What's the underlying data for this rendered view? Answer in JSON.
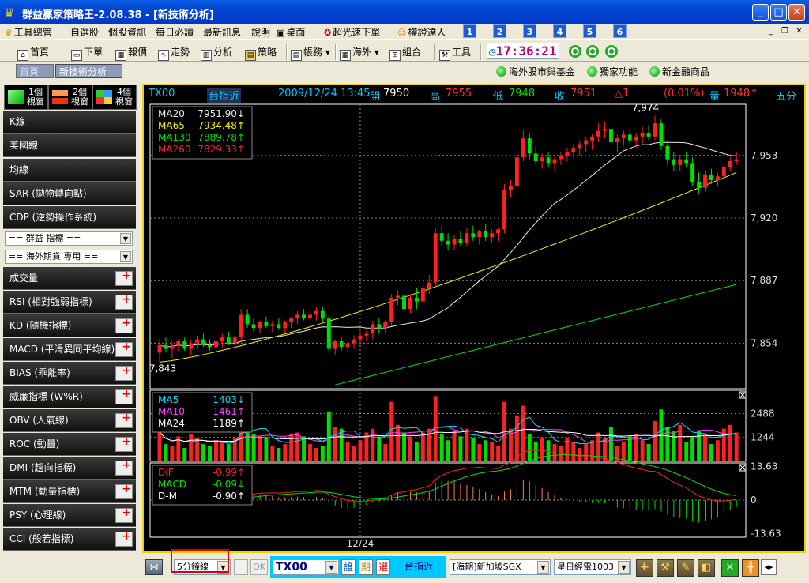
{
  "window": {
    "title": "群益贏家策略王-2.08.38 - [新技術分析]",
    "buttons": {
      "minimize": "_",
      "maximize": "□",
      "close": "✕"
    }
  },
  "menu": {
    "items": [
      "工具總管",
      "自選股",
      "個股資訊",
      "每日必讀",
      "最新訊息",
      "說明"
    ],
    "extras": [
      "桌面",
      "超光速下單",
      "權證達人"
    ],
    "numbers": [
      "1",
      "2",
      "3",
      "4",
      "5",
      "6"
    ]
  },
  "toolbar": {
    "items": [
      "首頁",
      "下單",
      "報價",
      "走勢",
      "分析",
      "策略",
      "帳務",
      "海外",
      "組合",
      "工具"
    ],
    "clock": "17:36:21"
  },
  "tabs": {
    "home": "首頁",
    "active": "新技術分析"
  },
  "links": [
    "海外股市與基金",
    "獨家功能",
    "新金融商品"
  ],
  "sidebar": {
    "views": [
      "1個視窗",
      "2個視窗",
      "4個視窗"
    ],
    "top_items": [
      "K線",
      "美國線",
      "均線",
      "SAR (拋物轉向點)",
      "CDP (逆勢操作系統)"
    ],
    "selects": [
      "==  群益 指標  ==",
      "==  海外期貨 專用  =="
    ],
    "indicators": [
      "成交量",
      "RSI (相對強弱指標)",
      "KD (隨機指標)",
      "MACD (平滑異同平均線)",
      "BIAS (乖離率)",
      "威廉指標 (W%R)",
      "OBV (人氣線)",
      "ROC (動量)",
      "DMI (趨向指標)",
      "MTM (動量指標)",
      "PSY (心理線)",
      "CCI (般若指標)"
    ]
  },
  "chart_header": {
    "symbol": "TX00",
    "name": "台指近",
    "datetime": "2009/12/24 13:45",
    "open_label": "開",
    "open": "7950",
    "high_label": "高",
    "high": "7955",
    "low_label": "低",
    "low": "7948",
    "close_label": "收",
    "close": "7951",
    "change": "△1",
    "pct": "(0.01%)",
    "vol_label": "量",
    "vol": "1948↑",
    "period": "五分"
  },
  "colors": {
    "up": "#FF2020",
    "down": "#00E000",
    "ma20": "#E8E8E8",
    "ma65": "#F2F000",
    "ma130": "#00E000",
    "ma260": "#FF2020",
    "accent": "#F0D000"
  },
  "chart_data": [
    {
      "type": "candlestick",
      "ylim": [
        7830,
        7980
      ],
      "yticks": [
        "7,953",
        "7,920",
        "7,887",
        "7,854"
      ],
      "annotations": {
        "high": "7,974",
        "low": "7,843"
      },
      "legend": [
        {
          "name": "MA20",
          "value": "7951.90↓"
        },
        {
          "name": "MA65",
          "value": "7934.48↑"
        },
        {
          "name": "MA130",
          "value": "7889.78↑"
        },
        {
          "name": "MA260",
          "value": "7829.33↑"
        }
      ],
      "ohlc": [
        [
          7849,
          7856,
          7844,
          7853
        ],
        [
          7853,
          7857,
          7849,
          7851
        ],
        [
          7851,
          7855,
          7846,
          7853
        ],
        [
          7853,
          7856,
          7850,
          7855
        ],
        [
          7855,
          7857,
          7850,
          7851
        ],
        [
          7851,
          7856,
          7848,
          7854
        ],
        [
          7854,
          7858,
          7851,
          7856
        ],
        [
          7856,
          7859,
          7852,
          7853
        ],
        [
          7853,
          7856,
          7850,
          7852
        ],
        [
          7852,
          7856,
          7848,
          7855
        ],
        [
          7855,
          7859,
          7852,
          7857
        ],
        [
          7857,
          7860,
          7853,
          7854
        ],
        [
          7854,
          7858,
          7851,
          7857
        ],
        [
          7857,
          7872,
          7855,
          7869
        ],
        [
          7869,
          7872,
          7862,
          7864
        ],
        [
          7864,
          7867,
          7860,
          7862
        ],
        [
          7862,
          7866,
          7859,
          7865
        ],
        [
          7865,
          7868,
          7862,
          7863
        ],
        [
          7863,
          7866,
          7860,
          7864
        ],
        [
          7864,
          7867,
          7861,
          7862
        ],
        [
          7862,
          7866,
          7859,
          7865
        ],
        [
          7865,
          7868,
          7862,
          7867
        ],
        [
          7867,
          7871,
          7864,
          7869
        ],
        [
          7869,
          7872,
          7866,
          7867
        ],
        [
          7867,
          7870,
          7864,
          7869
        ],
        [
          7869,
          7873,
          7866,
          7871
        ],
        [
          7871,
          7873,
          7865,
          7867
        ],
        [
          7867,
          7869,
          7849,
          7851
        ],
        [
          7851,
          7856,
          7848,
          7855
        ],
        [
          7855,
          7857,
          7850,
          7852
        ],
        [
          7852,
          7855,
          7849,
          7854
        ],
        [
          7854,
          7858,
          7851,
          7856
        ],
        [
          7856,
          7860,
          7853,
          7858
        ],
        [
          7858,
          7861,
          7855,
          7859
        ],
        [
          7859,
          7866,
          7856,
          7864
        ],
        [
          7864,
          7867,
          7859,
          7862
        ],
        [
          7862,
          7866,
          7859,
          7865
        ],
        [
          7865,
          7880,
          7863,
          7878
        ],
        [
          7878,
          7882,
          7874,
          7879
        ],
        [
          7879,
          7882,
          7869,
          7872
        ],
        [
          7872,
          7880,
          7870,
          7878
        ],
        [
          7878,
          7883,
          7872,
          7876
        ],
        [
          7876,
          7885,
          7874,
          7883
        ],
        [
          7883,
          7890,
          7880,
          7886
        ],
        [
          7886,
          7915,
          7884,
          7912
        ],
        [
          7912,
          7916,
          7905,
          7908
        ],
        [
          7908,
          7912,
          7903,
          7906
        ],
        [
          7906,
          7911,
          7903,
          7909
        ],
        [
          7909,
          7913,
          7905,
          7907
        ],
        [
          7907,
          7915,
          7905,
          7912
        ],
        [
          7912,
          7916,
          7908,
          7910
        ],
        [
          7910,
          7914,
          7906,
          7913
        ],
        [
          7913,
          7917,
          7908,
          7910
        ],
        [
          7910,
          7914,
          7907,
          7912
        ],
        [
          7912,
          7915,
          7908,
          7914
        ],
        [
          7914,
          7938,
          7912,
          7935
        ],
        [
          7935,
          7940,
          7931,
          7937
        ],
        [
          7937,
          7955,
          7934,
          7952
        ],
        [
          7952,
          7966,
          7950,
          7962
        ],
        [
          7962,
          7965,
          7951,
          7954
        ],
        [
          7954,
          7958,
          7948,
          7950
        ],
        [
          7950,
          7954,
          7946,
          7952
        ],
        [
          7952,
          7955,
          7947,
          7949
        ],
        [
          7949,
          7953,
          7945,
          7951
        ],
        [
          7951,
          7955,
          7948,
          7953
        ],
        [
          7953,
          7957,
          7950,
          7955
        ],
        [
          7955,
          7959,
          7952,
          7957
        ],
        [
          7957,
          7961,
          7953,
          7959
        ],
        [
          7959,
          7963,
          7955,
          7961
        ],
        [
          7961,
          7964,
          7956,
          7963
        ],
        [
          7963,
          7970,
          7960,
          7966
        ],
        [
          7966,
          7971,
          7962,
          7967
        ],
        [
          7967,
          7970,
          7958,
          7960
        ],
        [
          7960,
          7964,
          7955,
          7962
        ],
        [
          7962,
          7966,
          7958,
          7964
        ],
        [
          7964,
          7967,
          7959,
          7961
        ],
        [
          7961,
          7965,
          7957,
          7963
        ],
        [
          7963,
          7968,
          7959,
          7965
        ],
        [
          7965,
          7969,
          7961,
          7963
        ],
        [
          7963,
          7974,
          7961,
          7970
        ],
        [
          7970,
          7972,
          7956,
          7958
        ],
        [
          7958,
          7961,
          7948,
          7951
        ],
        [
          7951,
          7955,
          7945,
          7948
        ],
        [
          7948,
          7953,
          7945,
          7951
        ],
        [
          7951,
          7955,
          7947,
          7949
        ],
        [
          7949,
          7952,
          7937,
          7939
        ],
        [
          7939,
          7944,
          7933,
          7936
        ],
        [
          7936,
          7945,
          7934,
          7943
        ],
        [
          7943,
          7946,
          7938,
          7940
        ],
        [
          7940,
          7944,
          7937,
          7942
        ],
        [
          7942,
          7949,
          7940,
          7947
        ],
        [
          7947,
          7952,
          7945,
          7950
        ],
        [
          7950,
          7955,
          7948,
          7951
        ]
      ]
    },
    {
      "type": "bar",
      "yticks": [
        "2488",
        "1244"
      ],
      "ylim": [
        0,
        3700
      ],
      "legend": [
        {
          "name": "MA5",
          "value": "1403↓"
        },
        {
          "name": "MA10",
          "value": "1461↑"
        },
        {
          "name": "MA24",
          "value": "1189↑"
        }
      ],
      "volumes": [
        1500,
        900,
        800,
        1300,
        700,
        1400,
        1200,
        900,
        800,
        1100,
        1000,
        900,
        1200,
        3000,
        1600,
        1400,
        1300,
        1200,
        800,
        700,
        900,
        1400,
        1500,
        1300,
        900,
        700,
        800,
        2600,
        1800,
        1700,
        1000,
        800,
        1100,
        1500,
        1700,
        1200,
        900,
        3100,
        1900,
        1500,
        1300,
        1000,
        1500,
        1700,
        3400,
        1400,
        1100,
        1600,
        1300,
        1700,
        1200,
        900,
        1100,
        1000,
        800,
        3100,
        1700,
        2400,
        2900,
        1400,
        1000,
        1200,
        1100,
        900,
        800,
        1200,
        1000,
        700,
        900,
        1100,
        1500,
        1200,
        1800,
        800,
        1000,
        1300,
        1400,
        1100,
        900,
        2100,
        2700,
        1800,
        1600,
        1900,
        1000,
        1300,
        1600,
        1400,
        900,
        1100,
        1700,
        1900,
        1500
      ]
    },
    {
      "type": "line",
      "yticks": [
        "13.63",
        "0",
        "-13.63"
      ],
      "ylim": [
        -15,
        15
      ],
      "legend": [
        {
          "name": "DIF",
          "value": "-0.99↑"
        },
        {
          "name": "MACD",
          "value": "-0.09↓"
        },
        {
          "name": "D-M",
          "value": "-0.90↑"
        }
      ]
    }
  ],
  "xaxis_label": "12/24",
  "bottom": {
    "period_select": "5分鐘線",
    "ok_btn": "OK",
    "symbol": "TX00",
    "btn_a": "證",
    "btn_b": "期",
    "btn_c": "選",
    "name_display": "台指近",
    "market_select": "[海期]新加坡SGX",
    "product_select": "星日經電1003"
  }
}
